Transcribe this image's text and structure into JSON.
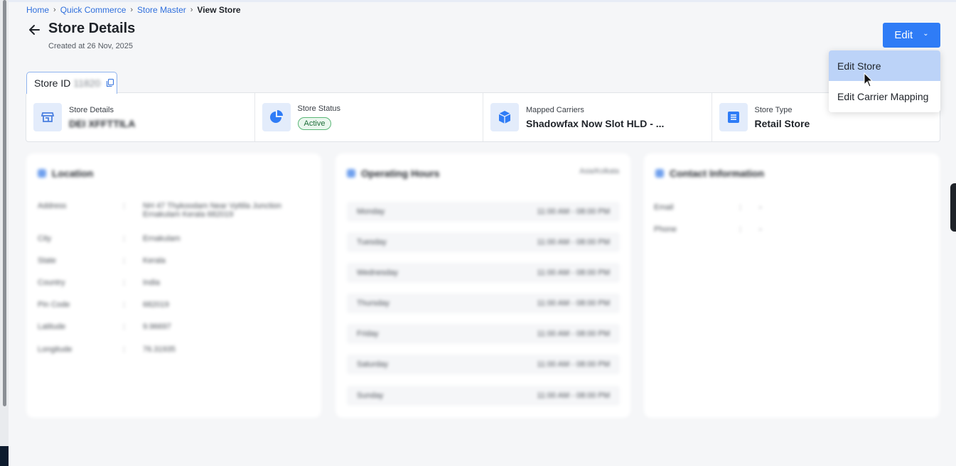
{
  "breadcrumb": {
    "home": "Home",
    "quick_commerce": "Quick Commerce",
    "store_master": "Store Master",
    "current": "View Store"
  },
  "header": {
    "title": "Store Details",
    "created": "Created at 26 Nov, 2025"
  },
  "edit_button": {
    "label": "Edit"
  },
  "edit_menu": {
    "items": [
      "Edit Store",
      "Edit Carrier Mapping"
    ]
  },
  "tab": {
    "label": "Store ID",
    "value": "11820"
  },
  "summary": {
    "store_details": {
      "label": "Store Details",
      "value": "DEI XFFTTILA"
    },
    "store_status": {
      "label": "Store Status",
      "value": "Active"
    },
    "mapped_carriers": {
      "label": "Mapped Carriers",
      "value": "Shadowfax Now Slot HLD - ..."
    },
    "store_type": {
      "label": "Store Type",
      "value": "Retail Store"
    }
  },
  "location": {
    "title": "Location",
    "fields": [
      {
        "key": "Address",
        "value": "NH 47 Thykoodam Near Vyttila Junction Ernakulam Kerala 682019"
      },
      {
        "key": "City",
        "value": "Ernakulam"
      },
      {
        "key": "State",
        "value": "Kerala"
      },
      {
        "key": "Country",
        "value": "India"
      },
      {
        "key": "Pin Code",
        "value": "682019"
      },
      {
        "key": "Latitude",
        "value": "9.96697"
      },
      {
        "key": "Longitude",
        "value": "76.31935"
      }
    ]
  },
  "hours": {
    "title": "Operating Hours",
    "zone": "Asia/Kolkata",
    "days": [
      {
        "day": "Monday",
        "time": "11:00 AM - 08:00 PM"
      },
      {
        "day": "Tuesday",
        "time": "11:00 AM - 08:00 PM"
      },
      {
        "day": "Wednesday",
        "time": "11:00 AM - 08:00 PM"
      },
      {
        "day": "Thursday",
        "time": "11:00 AM - 08:00 PM"
      },
      {
        "day": "Friday",
        "time": "11:00 AM - 08:00 PM"
      },
      {
        "day": "Saturday",
        "time": "11:00 AM - 08:00 PM"
      },
      {
        "day": "Sunday",
        "time": "11:00 AM - 08:00 PM"
      }
    ]
  },
  "contact": {
    "title": "Contact Information",
    "fields": [
      {
        "key": "Email",
        "value": "-"
      },
      {
        "key": "Phone",
        "value": "-"
      }
    ]
  }
}
